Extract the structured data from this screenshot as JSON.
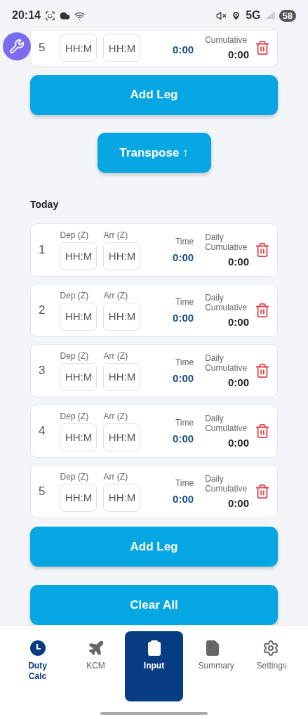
{
  "status_bar": {
    "time": "20:14",
    "network": "5G",
    "battery": "58"
  },
  "partial_leg": {
    "number": "5",
    "dep_placeholder": "HH:M",
    "arr_placeholder": "HH:M",
    "time": "0:00",
    "cumulative_label": "Cumulative",
    "cumulative": "0:00"
  },
  "buttons_top": [
    {
      "label": "Add Leg",
      "kind": "wide"
    },
    {
      "label": "Transpose ↑",
      "kind": "narrow"
    }
  ],
  "section_title": "Today",
  "legs": [
    {
      "number": "1",
      "dep_label": "Dep (Z)",
      "arr_label": "Arr (Z)",
      "dep_placeholder": "HH:M",
      "arr_placeholder": "HH:M",
      "time_label": "Time",
      "time": "0:00",
      "cumulative_label": "Daily Cumulative",
      "cumulative": "0:00"
    },
    {
      "number": "2",
      "dep_label": "Dep (Z)",
      "arr_label": "Arr (Z)",
      "dep_placeholder": "HH:M",
      "arr_placeholder": "HH:M",
      "time_label": "Time",
      "time": "0:00",
      "cumulative_label": "Daily Cumulative",
      "cumulative": "0:00"
    },
    {
      "number": "3",
      "dep_label": "Dep (Z)",
      "arr_label": "Arr (Z)",
      "dep_placeholder": "HH:M",
      "arr_placeholder": "HH:M",
      "time_label": "Time",
      "time": "0:00",
      "cumulative_label": "Daily Cumulative",
      "cumulative": "0:00"
    },
    {
      "number": "4",
      "dep_label": "Dep (Z)",
      "arr_label": "Arr (Z)",
      "dep_placeholder": "HH:M",
      "arr_placeholder": "HH:M",
      "time_label": "Time",
      "time": "0:00",
      "cumulative_label": "Daily Cumulative",
      "cumulative": "0:00"
    },
    {
      "number": "5",
      "dep_label": "Dep (Z)",
      "arr_label": "Arr (Z)",
      "dep_placeholder": "HH:M",
      "arr_placeholder": "HH:M",
      "time_label": "Time",
      "time": "0:00",
      "cumulative_label": "Daily Cumulative",
      "cumulative": "0:00"
    }
  ],
  "buttons_bottom": [
    {
      "label": "Add Leg"
    },
    {
      "label": "Clear All"
    }
  ],
  "nav": [
    {
      "label": "Duty Calc",
      "kind": "clock",
      "selected": false,
      "emphasized": true
    },
    {
      "label": "KCM",
      "kind": "plane",
      "selected": false,
      "emphasized": false
    },
    {
      "label": "Input",
      "kind": "clipboard",
      "selected": true,
      "emphasized": false
    },
    {
      "label": "Summary",
      "kind": "document",
      "selected": false,
      "emphasized": false
    },
    {
      "label": "Settings",
      "kind": "gear",
      "selected": false,
      "emphasized": false
    }
  ]
}
